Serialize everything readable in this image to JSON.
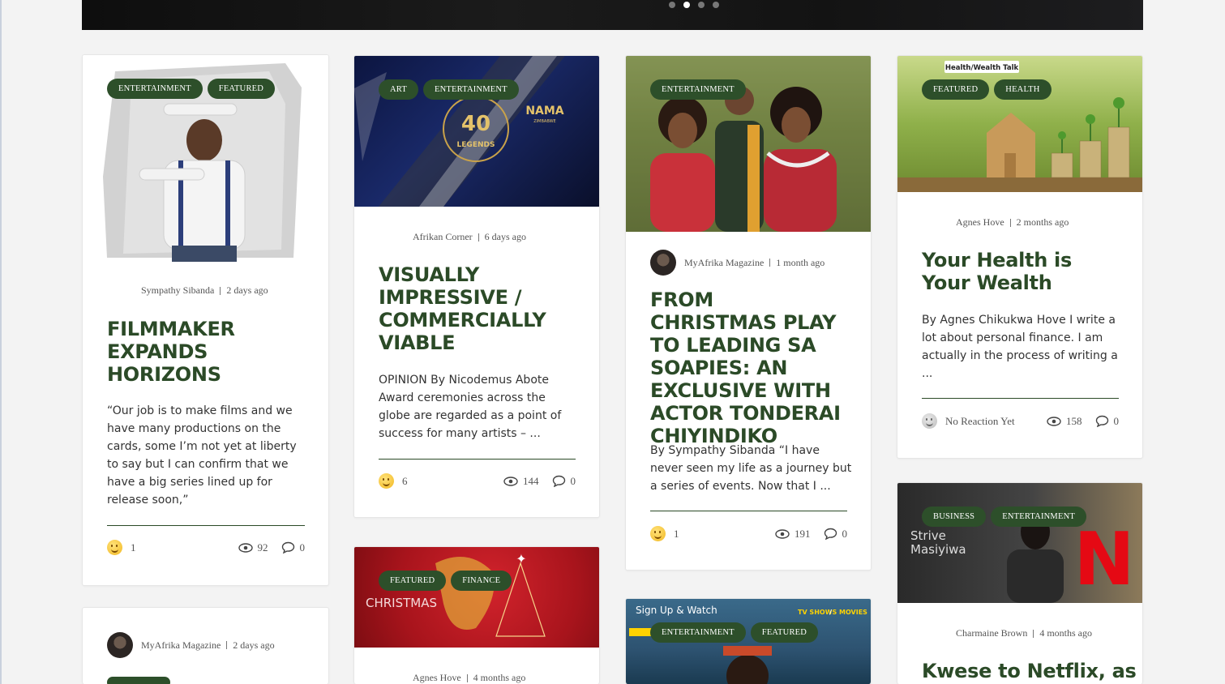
{
  "colors": {
    "accent": "#2d4f2a",
    "title": "#2b4a27",
    "background": "#f3f3f3"
  },
  "slider": {
    "dots": 4,
    "active_index": 1
  },
  "cards": [
    {
      "tags": [
        "ENTERTAINMENT",
        "FEATURED"
      ],
      "author": "Sympathy Sibanda",
      "time": "2 days ago",
      "title": "FILMMAKER EXPANDS HORIZONS",
      "excerpt": "“Our job is to make films and we have many productions on the cards, some I’m not yet at liberty to say but I can confirm that we have a big series lined up for release soon,”",
      "reactions": "1",
      "views": "92",
      "comments": "0"
    },
    {
      "tags": [
        "ART",
        "ENTERTAINMENT"
      ],
      "image_text": {
        "number": "40",
        "legends": "LEGENDS",
        "brand": "NAMA",
        "country": "ZIMBABWE"
      },
      "author": "Afrikan Corner",
      "time": "6 days ago",
      "title": "VISUALLY IMPRESSIVE / COMMERCIALLY VIABLE",
      "excerpt": "OPINION By Nicodemus Abote Award ceremonies across the globe are regarded as a point of success for many artists – ...",
      "reactions": "6",
      "views": "144",
      "comments": "0"
    },
    {
      "tags": [
        "ENTERTAINMENT"
      ],
      "author": "MyAfrika Magazine",
      "time": "1 month ago",
      "title": "FROM CHRISTMAS PLAY TO LEADING SA SOAPIES: AN EXCLUSIVE WITH ACTOR TONDERAI CHIYINDIKO",
      "excerpt": "By Sympathy Sibanda  “I have never seen my life as a journey but a series of events. Now that I ...",
      "reactions": "1",
      "views": "191",
      "comments": "0"
    },
    {
      "tags": [
        "FEATURED",
        "HEALTH"
      ],
      "image_text": {
        "banner": "Health/Wealth Talk"
      },
      "author": "Agnes Hove",
      "time": "2 months ago",
      "title": "Your Health is Your Wealth",
      "excerpt": "By Agnes Chikukwa Hove I write a lot about personal finance. I am actually in the process of writing a ...",
      "reactions": "No Reaction Yet",
      "views": "158",
      "comments": "0"
    },
    {
      "author": "MyAfrika Magazine",
      "time": "2 days ago"
    },
    {
      "tags": [
        "FEATURED",
        "FINANCE"
      ],
      "image_text": {
        "caption": "CHRISTMAS"
      },
      "author": "Agnes Hove",
      "time": "4 months ago"
    },
    {
      "tags": [
        "ENTERTAINMENT",
        "FEATURED"
      ],
      "image_text": {
        "left": "Sign Up & Watch",
        "right_a": "TV SHOWS",
        "right_b": "MOVIES"
      }
    },
    {
      "tags": [
        "BUSINESS",
        "ENTERTAINMENT"
      ],
      "image_text": {
        "name_a": "Strive",
        "name_b": "Masiyiwa",
        "logo": "N"
      },
      "author": "Charmaine Brown",
      "time": "4 months ago",
      "title": "Kwese to Netflix, as"
    }
  ]
}
